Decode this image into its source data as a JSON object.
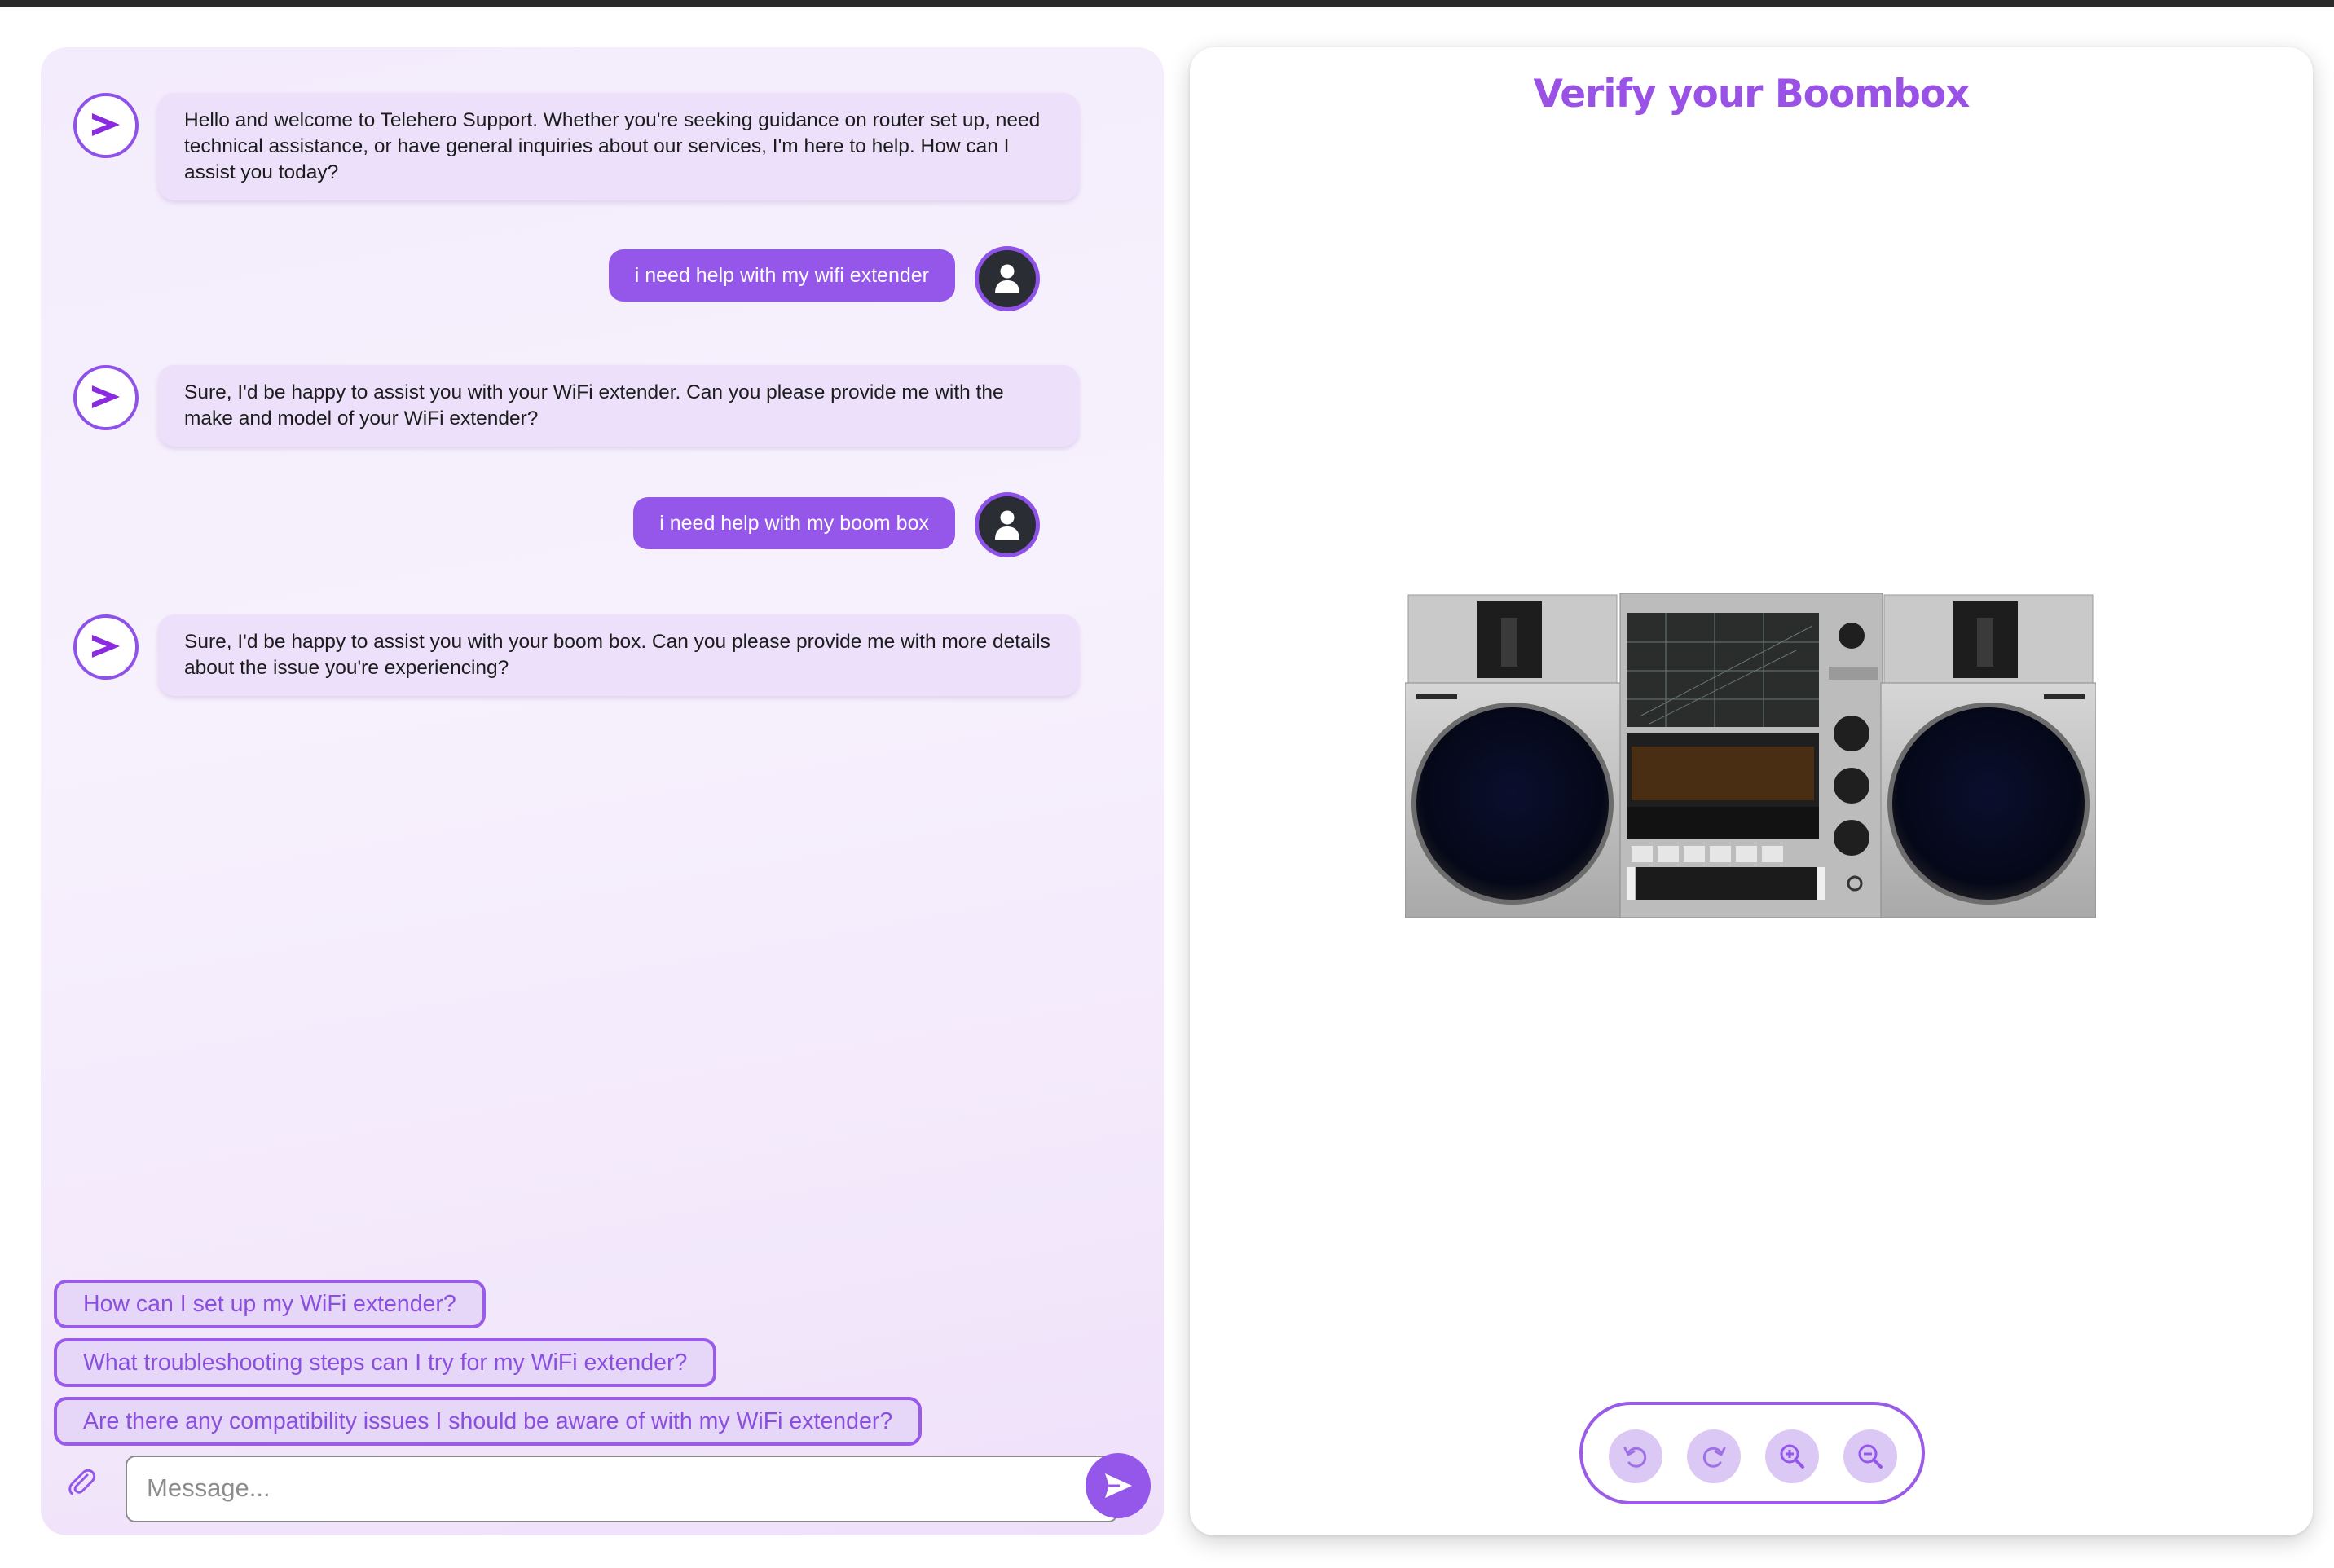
{
  "chat": {
    "messages": [
      {
        "sender": "bot",
        "text": "Hello and welcome to Telehero Support. Whether you're seeking guidance on router set up, need technical assistance, or have general inquiries about our services, I'm here to help. How can I assist you today?"
      },
      {
        "sender": "user",
        "text": "i need help with my wifi extender"
      },
      {
        "sender": "bot",
        "text": "Sure, I'd be happy to assist you with your WiFi extender. Can you please provide me with the make and model of your WiFi extender?"
      },
      {
        "sender": "user",
        "text": "i need help with my boom box"
      },
      {
        "sender": "bot",
        "text": "Sure, I'd be happy to assist you with your boom box. Can you please provide me with more details about the issue you're experiencing?"
      }
    ],
    "suggestions": [
      "How can I set up my WiFi extender?",
      "What troubleshooting steps can I try for my WiFi extender?",
      "Are there any compatibility issues I should be aware of with my WiFi extender?"
    ],
    "input": {
      "placeholder": "Message...",
      "value": ""
    }
  },
  "viewer": {
    "title": "Verify your Boombox",
    "controls": [
      "rotate-left-icon",
      "rotate-right-icon",
      "zoom-in-icon",
      "zoom-out-icon"
    ]
  },
  "colors": {
    "accent": "#9457ea",
    "bot_bubble": "#ece0fa",
    "chip_background": "#e6d6f8",
    "title": "#9a52e6"
  }
}
